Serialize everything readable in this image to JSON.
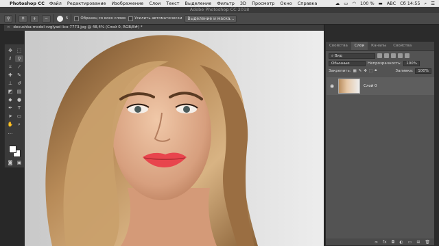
{
  "menubar": {
    "app_name": "Photoshop CC",
    "items": [
      "Файл",
      "Редактирование",
      "Изображение",
      "Слои",
      "Текст",
      "Выделение",
      "Фильтр",
      "3D",
      "Просмотр",
      "Окно",
      "Справка"
    ],
    "battery": "100 %",
    "input_source": "ABC",
    "clock": "Сб 14:55"
  },
  "window": {
    "title": "Adobe Photoshop CC 2018"
  },
  "options_bar": {
    "brush_size": "5",
    "sample_all_layers_label": "Образец со всех слоев",
    "enhance_auto_label": "Усилить автоматически",
    "select_mask_label": "Выделение и маска..."
  },
  "document": {
    "tab_title": "devushka-model-vzglyad-lico-7773.jpg @ 48,4% (Слой 0, RGB/8#) *"
  },
  "panel": {
    "tabs": [
      "Свойства",
      "Слои",
      "Каналы",
      "Свойства"
    ],
    "active_tab_index": 1,
    "filter_label": "Вид",
    "blend_mode": "Обычные",
    "opacity_label": "Непрозрачность:",
    "opacity_value": "100%",
    "lock_label": "Закрепить:",
    "fill_label": "Заливка:",
    "fill_value": "100%",
    "layer_name": "Слой 0"
  }
}
